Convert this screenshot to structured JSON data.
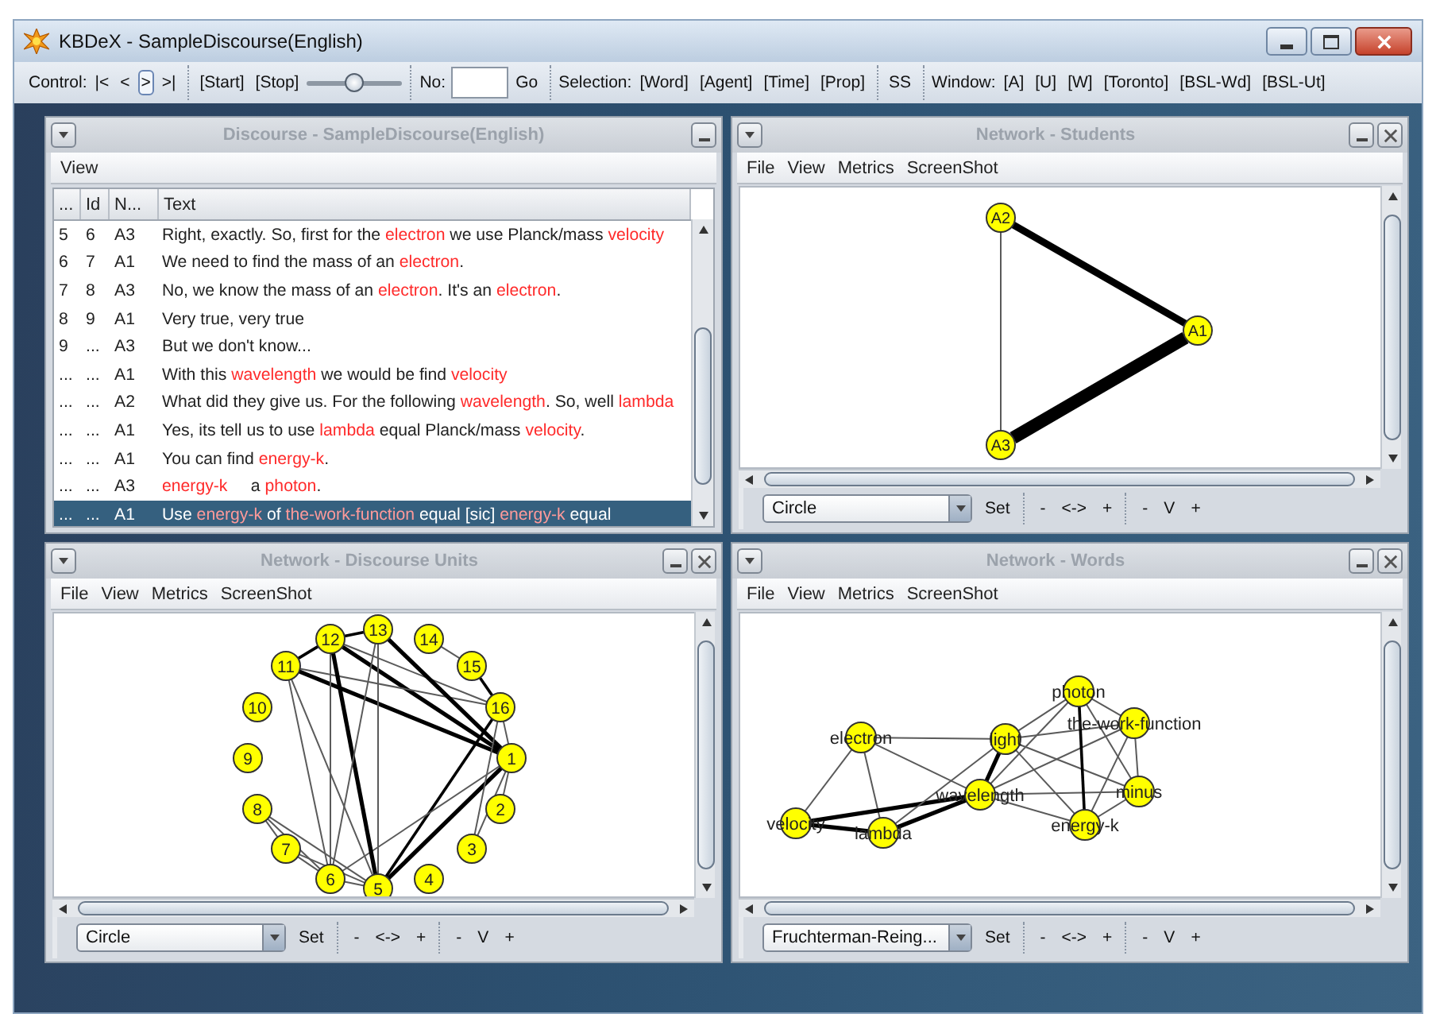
{
  "window": {
    "title": "KBDeX - SampleDiscourse(English)"
  },
  "toolbar": {
    "groups": [
      {
        "items": [
          {
            "kind": "label",
            "text": "Control:"
          },
          {
            "kind": "button",
            "text": "|<",
            "selected": false
          },
          {
            "kind": "button",
            "text": "<",
            "selected": false
          },
          {
            "kind": "button",
            "text": ">",
            "selected": true
          },
          {
            "kind": "button",
            "text": ">|",
            "selected": false
          }
        ]
      },
      {
        "items": [
          {
            "kind": "button",
            "text": "[Start]"
          },
          {
            "kind": "button",
            "text": "[Stop]"
          },
          {
            "kind": "slider",
            "level": 0.5
          }
        ]
      },
      {
        "items": [
          {
            "kind": "label",
            "text": "No:"
          },
          {
            "kind": "field"
          },
          {
            "kind": "button",
            "text": "Go"
          }
        ]
      },
      {
        "items": [
          {
            "kind": "label",
            "text": "Selection:"
          },
          {
            "kind": "button",
            "text": "[Word]"
          },
          {
            "kind": "button",
            "text": "[Agent]"
          },
          {
            "kind": "button",
            "text": "[Time]"
          },
          {
            "kind": "button",
            "text": "[Prop]"
          }
        ]
      },
      {
        "items": [
          {
            "kind": "button",
            "text": "SS"
          }
        ]
      },
      {
        "items": [
          {
            "kind": "label",
            "text": "Window:"
          },
          {
            "kind": "button",
            "text": "[A]"
          },
          {
            "kind": "button",
            "text": "[U]"
          },
          {
            "kind": "button",
            "text": "[W]"
          },
          {
            "kind": "button",
            "text": "[Toronto]"
          },
          {
            "kind": "button",
            "text": "[BSL-Wd]"
          },
          {
            "kind": "button",
            "text": "[BSL-Ut]"
          }
        ]
      }
    ]
  },
  "panels": [
    {
      "kind": "table",
      "title": "Discourse - SampleDiscourse(English)",
      "closable": false,
      "menu": [
        "View"
      ],
      "columns": [
        "...",
        "Id",
        "N...",
        "Text"
      ],
      "rows": [
        {
          "selected": false,
          "cells": [
            "5",
            "6",
            "A3"
          ],
          "text": [
            {
              "s": "Right, exactly. So, first for the ",
              "keyword": false
            },
            {
              "s": "electron",
              "keyword": true
            },
            {
              "s": " we use Planck/mass ",
              "keyword": false
            },
            {
              "s": "velocity",
              "keyword": true
            }
          ]
        },
        {
          "selected": false,
          "cells": [
            "6",
            "7",
            "A1"
          ],
          "text": [
            {
              "s": "We need to find the mass of an ",
              "keyword": false
            },
            {
              "s": "electron",
              "keyword": true
            },
            {
              "s": ".",
              "keyword": false
            }
          ]
        },
        {
          "selected": false,
          "cells": [
            "7",
            "8",
            "A3"
          ],
          "text": [
            {
              "s": "No, we know the mass of an ",
              "keyword": false
            },
            {
              "s": "electron",
              "keyword": true
            },
            {
              "s": ". It's an ",
              "keyword": false
            },
            {
              "s": "electron",
              "keyword": true
            },
            {
              "s": ".",
              "keyword": false
            }
          ]
        },
        {
          "selected": false,
          "cells": [
            "8",
            "9",
            "A1"
          ],
          "text": [
            {
              "s": "Very true, very true",
              "keyword": false
            }
          ]
        },
        {
          "selected": false,
          "cells": [
            "9",
            "...",
            "A3"
          ],
          "text": [
            {
              "s": "But we don't know...",
              "keyword": false
            }
          ]
        },
        {
          "selected": false,
          "cells": [
            "...",
            "...",
            "A1"
          ],
          "text": [
            {
              "s": "With this ",
              "keyword": false
            },
            {
              "s": "wavelength",
              "keyword": true
            },
            {
              "s": " we would be find ",
              "keyword": false
            },
            {
              "s": "velocity",
              "keyword": true
            }
          ]
        },
        {
          "selected": false,
          "cells": [
            "...",
            "...",
            "A2"
          ],
          "text": [
            {
              "s": "What did they give us. For the following ",
              "keyword": false
            },
            {
              "s": "wavelength",
              "keyword": true
            },
            {
              "s": ". So, well ",
              "keyword": false
            },
            {
              "s": "lambda",
              "keyword": true
            }
          ]
        },
        {
          "selected": false,
          "cells": [
            "...",
            "...",
            "A1"
          ],
          "text": [
            {
              "s": "Yes, its tell us to use ",
              "keyword": false
            },
            {
              "s": "lambda",
              "keyword": true
            },
            {
              "s": " equal Planck/mass ",
              "keyword": false
            },
            {
              "s": "velocity",
              "keyword": true
            },
            {
              "s": ".",
              "keyword": false
            }
          ]
        },
        {
          "selected": false,
          "cells": [
            "...",
            "...",
            "A1"
          ],
          "text": [
            {
              "s": "You can find ",
              "keyword": false
            },
            {
              "s": "energy-k",
              "keyword": true
            },
            {
              "s": ".",
              "keyword": false
            }
          ]
        },
        {
          "selected": false,
          "cells": [
            "...",
            "...",
            "A3"
          ],
          "text": [
            {
              "s": "energy-k",
              "keyword": true
            },
            {
              "s": "     a ",
              "keyword": false
            },
            {
              "s": "photon",
              "keyword": true
            },
            {
              "s": ".",
              "keyword": false
            }
          ]
        },
        {
          "selected": true,
          "cells": [
            "...",
            "...",
            "A1"
          ],
          "text": [
            {
              "s": "Use ",
              "keyword": false
            },
            {
              "s": "energy-k",
              "keyword": true
            },
            {
              "s": " of ",
              "keyword": false
            },
            {
              "s": "the-work-function",
              "keyword": true
            },
            {
              "s": " equal [sic] ",
              "keyword": false
            },
            {
              "s": "energy-k",
              "keyword": true
            },
            {
              "s": " equal",
              "keyword": false
            }
          ]
        }
      ]
    },
    {
      "kind": "network",
      "title": "Network - Students",
      "closable": true,
      "menu": [
        "File",
        "View",
        "Metrics",
        "ScreenShot"
      ],
      "nodes": [
        {
          "label": "A1"
        },
        {
          "label": "A2"
        },
        {
          "label": "A3"
        }
      ],
      "controls": {
        "layout": "Circle",
        "set": "Set",
        "width": [
          "-",
          "<->",
          "+"
        ],
        "height": [
          "-",
          "V",
          "+"
        ]
      }
    },
    {
      "kind": "network",
      "title": "Network - Discourse Units",
      "closable": true,
      "menu": [
        "File",
        "View",
        "Metrics",
        "ScreenShot"
      ],
      "nodes": [
        {
          "label": "1"
        },
        {
          "label": "2"
        },
        {
          "label": "3"
        },
        {
          "label": "4"
        },
        {
          "label": "5"
        },
        {
          "label": "6"
        },
        {
          "label": "7"
        },
        {
          "label": "8"
        },
        {
          "label": "9"
        },
        {
          "label": "10"
        },
        {
          "label": "11"
        },
        {
          "label": "12"
        },
        {
          "label": "13"
        },
        {
          "label": "14"
        },
        {
          "label": "15"
        },
        {
          "label": "16"
        }
      ],
      "controls": {
        "layout": "Circle",
        "set": "Set",
        "width": [
          "-",
          "<->",
          "+"
        ],
        "height": [
          "-",
          "V",
          "+"
        ]
      }
    },
    {
      "kind": "network",
      "title": "Network - Words",
      "closable": true,
      "menu": [
        "File",
        "View",
        "Metrics",
        "ScreenShot"
      ],
      "nodes": [
        {
          "label": "photon"
        },
        {
          "label": "the-work-function"
        },
        {
          "label": "electron"
        },
        {
          "label": "light"
        },
        {
          "label": "minus"
        },
        {
          "label": "wavelength"
        },
        {
          "label": "velocity"
        },
        {
          "label": "lambda"
        },
        {
          "label": "energy-k"
        }
      ],
      "controls": {
        "layout": "Fruchterman-Reing...",
        "set": "Set",
        "width": [
          "-",
          "<->",
          "+"
        ],
        "height": [
          "-",
          "V",
          "+"
        ]
      }
    }
  ]
}
